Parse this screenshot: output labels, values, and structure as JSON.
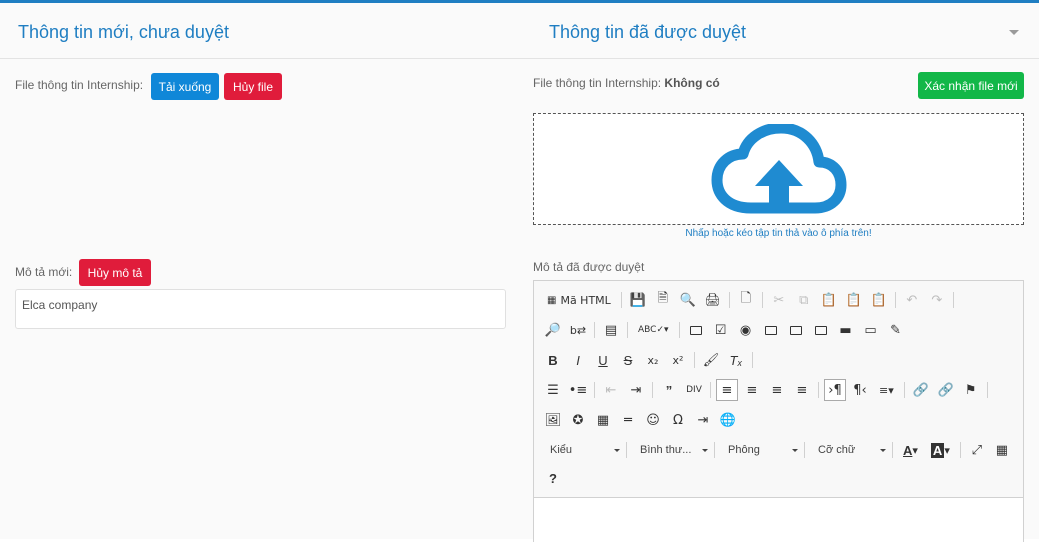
{
  "header": {
    "left_title": "Thông tin mới, chưa duyệt",
    "right_title": "Thông tin đã được duyệt"
  },
  "left": {
    "file_label": "File thông tin Internship:",
    "download_button": "Tải xuống",
    "cancel_file_button": "Hủy file",
    "desc_label": "Mô tả mới:",
    "cancel_desc_button": "Hủy mô tả",
    "desc_value": "Elca company"
  },
  "right": {
    "file_label": "File thông tin Internship:",
    "file_status": "Không có",
    "confirm_button": "Xác nhận file mới",
    "dropzone_hint": "Nhấp hoặc kéo tập tin thả vào ô phía trên!",
    "desc_label": "Mô tả đã được duyệt"
  },
  "editor": {
    "source_label": "Mã HTML",
    "style_combo": "Kiểu",
    "format_combo": "Bình thư...",
    "font_combo": "Phông",
    "size_combo": "Cỡ chữ",
    "help": "?"
  },
  "colors": {
    "accent": "#1f7ec2",
    "blue_button": "#0f87d8",
    "red_button": "#e01c3b",
    "green_button": "#12b748"
  }
}
